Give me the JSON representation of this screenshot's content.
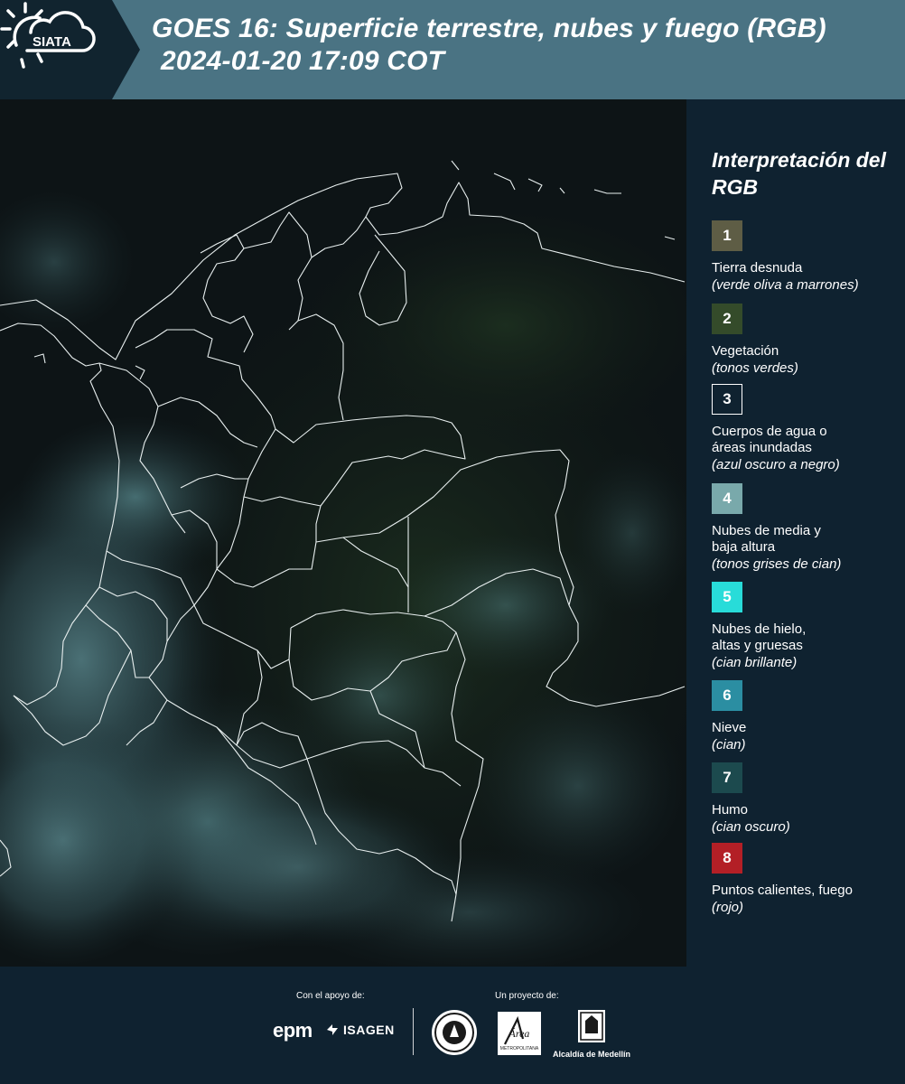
{
  "header": {
    "logo_text": "SIATA",
    "title_line1": "GOES 16: Superficie terrestre, nubes y fuego (RGB)",
    "title_line2": "2024-01-20 17:09 COT",
    "background": "#4a7383",
    "logo_background": "#11242f"
  },
  "legend": {
    "title": "Interpretación del RGB",
    "items": [
      {
        "number": "1",
        "label": "Tierra desnuda",
        "note": "(verde oliva a marrones)",
        "color": "#5e5d45"
      },
      {
        "number": "2",
        "label": "Vegetación",
        "note": "(tonos verdes)",
        "color": "#344b2a"
      },
      {
        "number": "3",
        "label": "Cuerpos de agua o áreas inundadas",
        "note": "(azul oscuro a negro)",
        "color": "#0f2230"
      },
      {
        "number": "4",
        "label": "Nubes de media y baja altura",
        "note": "(tonos grises de cian)",
        "color": "#79a9ab"
      },
      {
        "number": "5",
        "label": "Nubes de hielo, altas y gruesas",
        "note": "(cian brillante)",
        "color": "#28dcd9"
      },
      {
        "number": "6",
        "label": "Nieve",
        "note": "(cian)",
        "color": "#2b8ea2"
      },
      {
        "number": "7",
        "label": "Humo",
        "note": "(cian oscuro)",
        "color": "#1c4a4e"
      },
      {
        "number": "8",
        "label": "Puntos calientes, fuego",
        "note": "(rojo)",
        "color": "#b31f26"
      }
    ]
  },
  "footer": {
    "support_label": "Con el apoyo de:",
    "project_label": "Un proyecto de:",
    "epm": "epm",
    "isagen": "ISAGEN",
    "area_metropolitana": "Área",
    "area_subtitle": "METROPOLITANA",
    "alcaldia": "Alcaldía de Medellín"
  }
}
